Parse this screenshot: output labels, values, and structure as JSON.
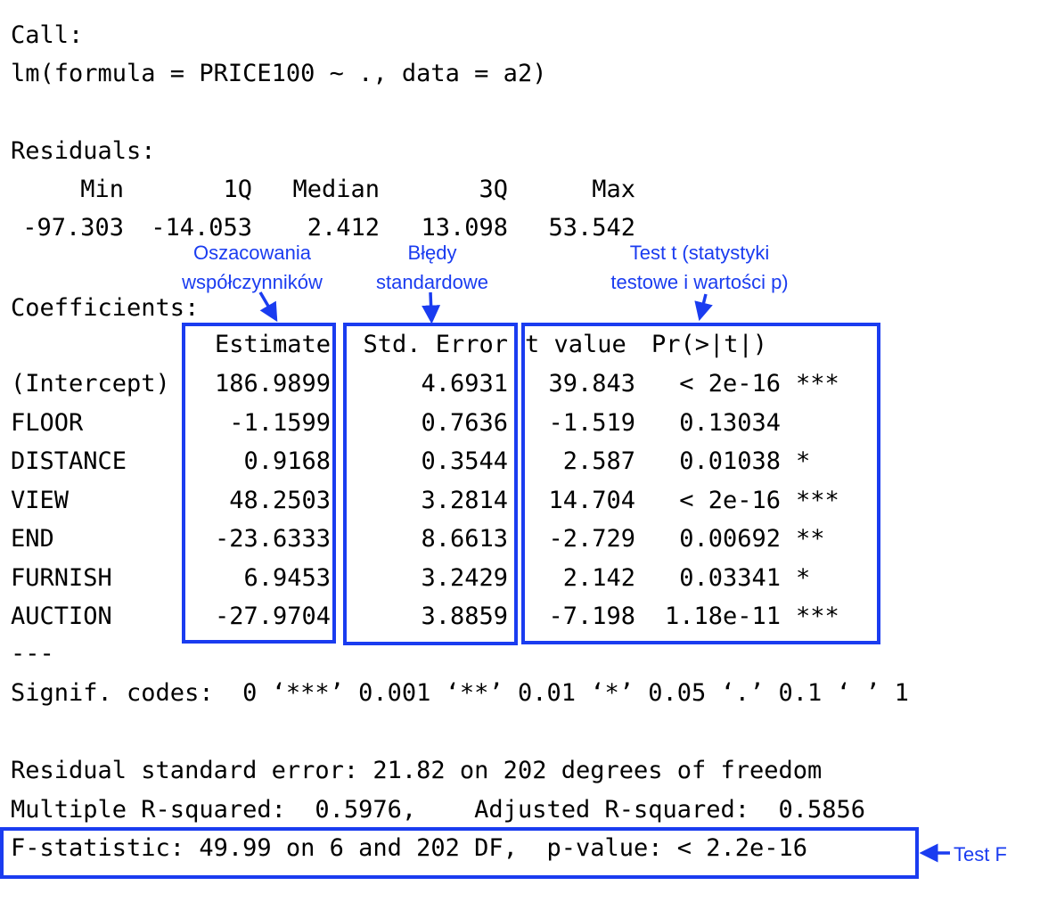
{
  "call": {
    "label": "Call:",
    "formula": "lm(formula = PRICE100 ~ ., data = a2)"
  },
  "residuals": {
    "label": "Residuals:",
    "headers": [
      "Min",
      "1Q",
      "Median",
      "3Q",
      "Max"
    ],
    "values": [
      "-97.303",
      "-14.053",
      "2.412",
      "13.098",
      "53.542"
    ]
  },
  "coefficients": {
    "label": "Coefficients:",
    "headers": {
      "estimate": "Estimate",
      "std_error": "Std. Error",
      "t_value": "t value",
      "p_value": "Pr(>|t|)"
    },
    "rows": [
      {
        "name": "(Intercept)",
        "estimate": "186.9899",
        "std_error": "4.6931",
        "t_value": "39.843",
        "p_value": "< 2e-16",
        "signif": "***"
      },
      {
        "name": "FLOOR",
        "estimate": "-1.1599",
        "std_error": "0.7636",
        "t_value": "-1.519",
        "p_value": "0.13034",
        "signif": ""
      },
      {
        "name": "DISTANCE",
        "estimate": "0.9168",
        "std_error": "0.3544",
        "t_value": "2.587",
        "p_value": "0.01038",
        "signif": "*"
      },
      {
        "name": "VIEW",
        "estimate": "48.2503",
        "std_error": "3.2814",
        "t_value": "14.704",
        "p_value": "< 2e-16",
        "signif": "***"
      },
      {
        "name": "END",
        "estimate": "-23.6333",
        "std_error": "8.6613",
        "t_value": "-2.729",
        "p_value": "0.00692",
        "signif": "**"
      },
      {
        "name": "FURNISH",
        "estimate": "6.9453",
        "std_error": "3.2429",
        "t_value": "2.142",
        "p_value": "0.03341",
        "signif": "*"
      },
      {
        "name": "AUCTION",
        "estimate": "-27.9704",
        "std_error": "3.8859",
        "t_value": "-7.198",
        "p_value": "1.18e-11",
        "signif": "***"
      }
    ]
  },
  "separator": "---",
  "signif_codes": "Signif. codes:  0 ‘***’ 0.001 ‘**’ 0.01 ‘*’ 0.05 ‘.’ 0.1 ‘ ’ 1",
  "summary": {
    "residual_se": "Residual standard error: 21.82 on 202 degrees of freedom",
    "r_squared": "Multiple R-squared:  0.5976,\tAdjusted R-squared:  0.5856",
    "f_statistic": "F-statistic: 49.99 on 6 and 202 DF,  p-value: < 2.2e-16"
  },
  "annotations": {
    "estimates": "Oszacowania\nwspółczynników",
    "std_errors": "Błędy\nstandardowe",
    "t_test": "Test t (statystyki\ntestowe i wartości p)",
    "f_test": "Test F"
  },
  "colors": {
    "annotation": "#1a3cf0",
    "text": "#000000"
  }
}
